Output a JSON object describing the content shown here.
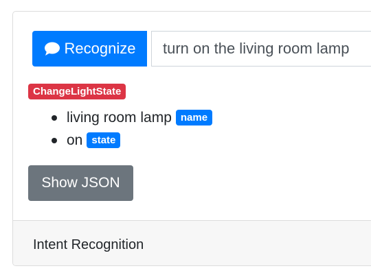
{
  "recognize": {
    "button_label": "Recognize",
    "icon": "comment-icon"
  },
  "query": {
    "value": "turn on the living room lamp"
  },
  "intent": {
    "name": "ChangeLightState"
  },
  "entities": [
    {
      "value": "living room lamp",
      "entity": "name"
    },
    {
      "value": "on",
      "entity": "state"
    }
  ],
  "actions": {
    "show_json_label": "Show JSON"
  },
  "footer": {
    "title": "Intent Recognition"
  },
  "colors": {
    "primary": "#007bff",
    "danger": "#dc3545",
    "secondary": "#6c757d"
  }
}
